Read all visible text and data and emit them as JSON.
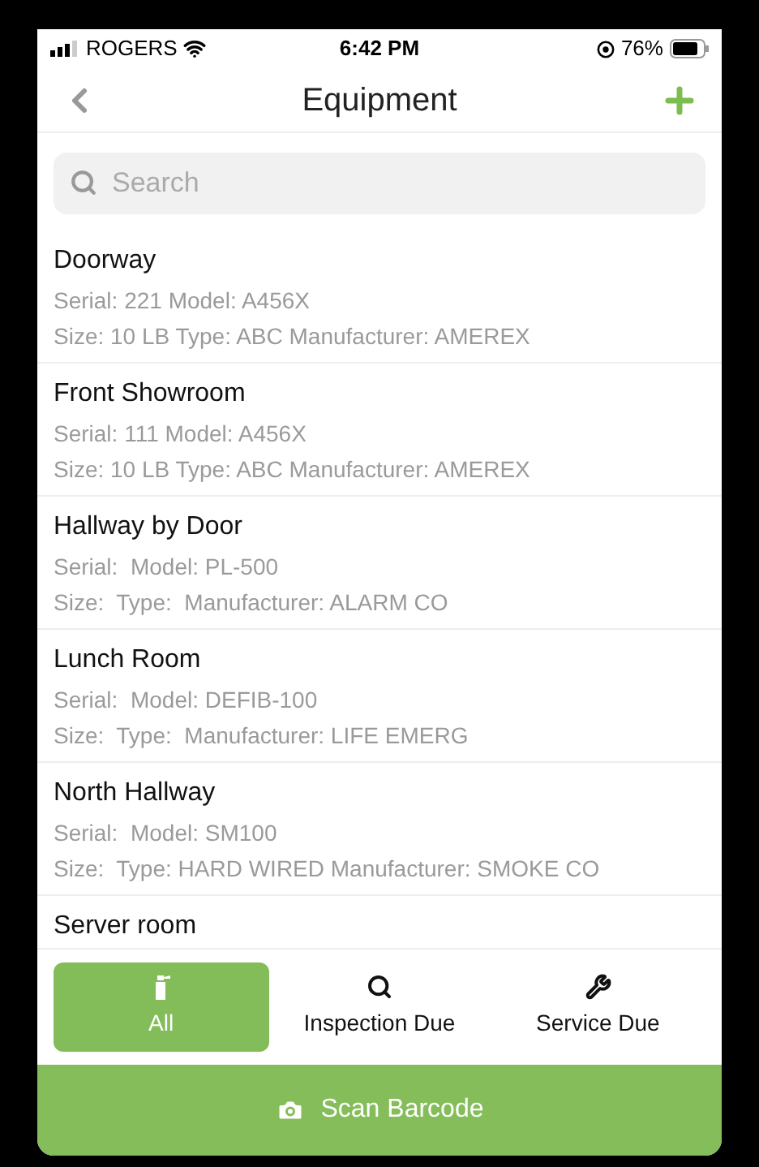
{
  "status_bar": {
    "carrier": "ROGERS",
    "time": "6:42 PM",
    "battery": "76%"
  },
  "nav": {
    "title": "Equipment"
  },
  "search": {
    "placeholder": "Search"
  },
  "items": [
    {
      "name": "Doorway",
      "line_1": "Serial: 221 Model: A456X",
      "line_2": "Size: 10 LB Type: ABC Manufacturer: AMEREX"
    },
    {
      "name": "Front Showroom",
      "line_1": "Serial: 111 Model: A456X",
      "line_2": "Size: 10 LB Type: ABC Manufacturer: AMEREX"
    },
    {
      "name": "Hallway by Door",
      "line_1": "Serial:  Model: PL-500",
      "line_2": "Size:  Type:  Manufacturer: ALARM CO"
    },
    {
      "name": "Lunch Room",
      "line_1": "Serial:  Model: DEFIB-100",
      "line_2": "Size:  Type:  Manufacturer: LIFE EMERG"
    },
    {
      "name": "North Hallway",
      "line_1": "Serial:  Model: SM100",
      "line_2": "Size:  Type: HARD WIRED Manufacturer: SMOKE CO"
    },
    {
      "name": "Server room"
    }
  ],
  "filters": [
    {
      "kind": "extinguisher",
      "label": "All",
      "selected": true
    },
    {
      "kind": "search",
      "label": "Inspection Due",
      "selected": false
    },
    {
      "kind": "wrench",
      "label": "Service Due",
      "selected": false
    }
  ],
  "scan_button": {
    "label": "Scan Barcode"
  }
}
